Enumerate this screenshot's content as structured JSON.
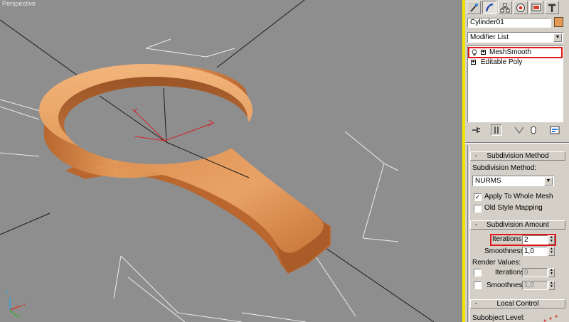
{
  "viewport": {
    "label": "Perspective",
    "axis_x": "x",
    "axis_y": "y",
    "axis_z": "z"
  },
  "colors": {
    "viewport_bg": "#8e8e8e",
    "object_color": "#e39a58",
    "active_border": "#f1e300",
    "highlight": "#e11818",
    "panel_bg": "#d4d0c8"
  },
  "command_panel": {
    "tabs": [
      {
        "icon": "create-icon"
      },
      {
        "icon": "modify-icon"
      },
      {
        "icon": "hierarchy-icon"
      },
      {
        "icon": "motion-icon"
      },
      {
        "icon": "display-icon"
      },
      {
        "icon": "utilities-icon"
      }
    ],
    "object_name": "Cylinder01",
    "modifier_list_label": "Modifier List",
    "stack": [
      {
        "label": "MeshSmooth",
        "selected": true
      },
      {
        "label": "Editable Poly",
        "selected": false
      }
    ],
    "tools": [
      "pin-stack-icon",
      "show-end-result-icon",
      "make-unique-icon",
      "remove-modifier-icon",
      "configure-sets-icon"
    ]
  },
  "subdivision_method": {
    "title": "Subdivision Method",
    "method_label": "Subdivision Method:",
    "method_value": "NURMS",
    "apply_whole_mesh_label": "Apply To Whole Mesh",
    "apply_whole_mesh_checked": true,
    "old_style_label": "Old Style Mapping",
    "old_style_checked": false
  },
  "subdivision_amount": {
    "title": "Subdivision Amount",
    "iterations_label": "Iterations:",
    "iterations_value": "2",
    "smoothness_label": "Smoothness:",
    "smoothness_value": "1,0",
    "render_values_label": "Render Values:",
    "render_iterations_label": "Iterations:",
    "render_iterations_value": "0",
    "render_smoothness_label": "Smoothness:",
    "render_smoothness_value": "1,0"
  },
  "local_control": {
    "title": "Local Control",
    "subobject_label": "Subobject Level:"
  }
}
